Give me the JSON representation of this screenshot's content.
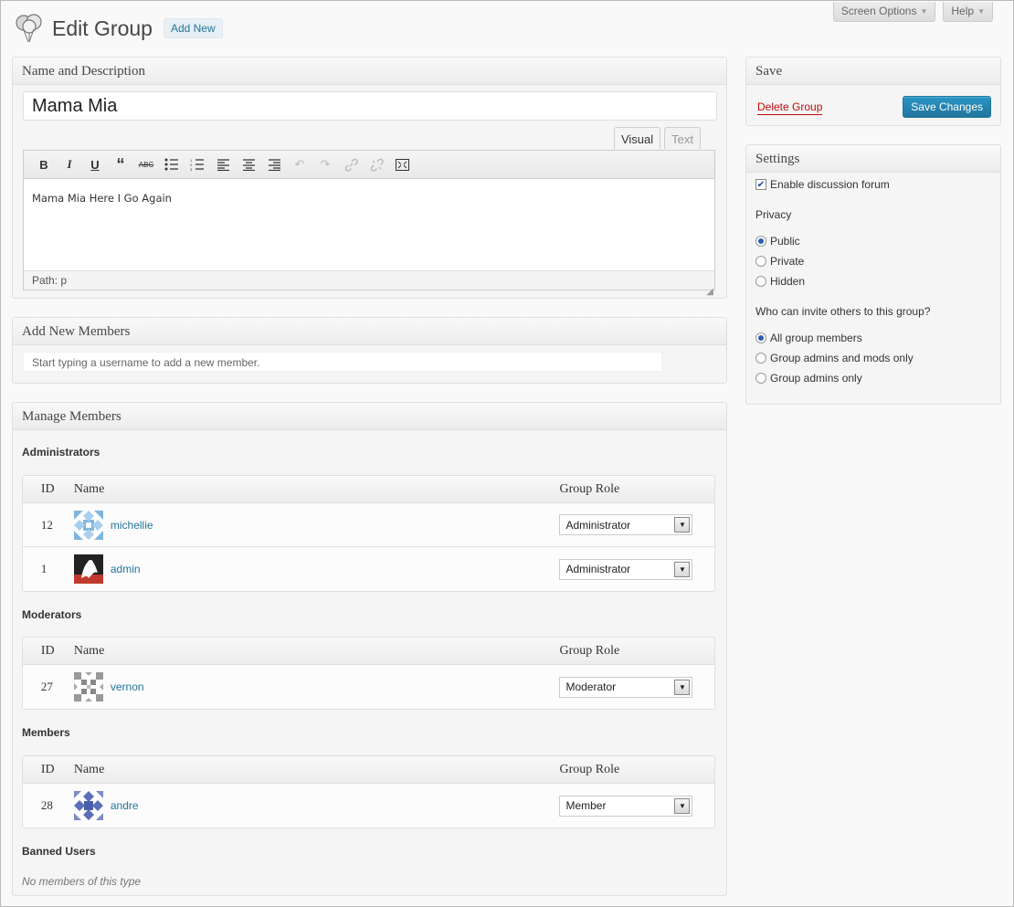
{
  "header": {
    "title": "Edit Group",
    "add_new_label": "Add New",
    "screen_options_label": "Screen Options",
    "help_label": "Help"
  },
  "name_box": {
    "heading": "Name and Description",
    "group_name": "Mama Mia",
    "tabs": {
      "visual": "Visual",
      "text": "Text"
    },
    "description": "Mama Mia Here I Go Again",
    "path": "Path: p"
  },
  "add_members": {
    "heading": "Add New Members",
    "placeholder": "Start typing a username to add a new member."
  },
  "manage": {
    "heading": "Manage Members",
    "columns": {
      "id": "ID",
      "name": "Name",
      "role": "Group Role"
    },
    "administrators_label": "Administrators",
    "administrators": [
      {
        "id": "12",
        "name": "michellie",
        "role": "Administrator"
      },
      {
        "id": "1",
        "name": "admin",
        "role": "Administrator"
      }
    ],
    "moderators_label": "Moderators",
    "moderators": [
      {
        "id": "27",
        "name": "vernon",
        "role": "Moderator"
      }
    ],
    "members_label": "Members",
    "members": [
      {
        "id": "28",
        "name": "andre",
        "role": "Member"
      }
    ],
    "banned_label": "Banned Users",
    "banned_empty": "No members of this type"
  },
  "save_box": {
    "heading": "Save",
    "delete_label": "Delete Group",
    "save_label": "Save Changes"
  },
  "settings": {
    "heading": "Settings",
    "forum_label": "Enable discussion forum",
    "forum_enabled": true,
    "privacy_label": "Privacy",
    "privacy_options": [
      "Public",
      "Private",
      "Hidden"
    ],
    "privacy_selected": 0,
    "invite_label": "Who can invite others to this group?",
    "invite_options": [
      "All group members",
      "Group admins and mods only",
      "Group admins only"
    ],
    "invite_selected": 0
  },
  "colors": {
    "link": "#21759b",
    "delete": "#bc0b0b",
    "primary_button": "#21759b"
  }
}
